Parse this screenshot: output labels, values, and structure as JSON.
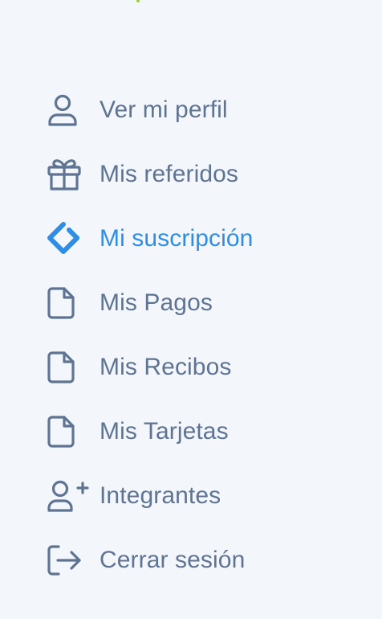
{
  "menu": {
    "items": [
      {
        "label": "Ver mi perfil",
        "icon": "user-icon",
        "active": false
      },
      {
        "label": "Mis referidos",
        "icon": "gift-icon",
        "active": false
      },
      {
        "label": "Mi suscripción",
        "icon": "subscription-tag-icon",
        "active": true
      },
      {
        "label": "Mis Pagos",
        "icon": "document-icon",
        "active": false
      },
      {
        "label": "Mis Recibos",
        "icon": "document-icon",
        "active": false
      },
      {
        "label": "Mis Tarjetas",
        "icon": "document-icon",
        "active": false
      },
      {
        "label": "Integrantes",
        "icon": "user-plus-icon",
        "active": false
      },
      {
        "label": "Cerrar sesión",
        "icon": "logout-icon",
        "active": false
      }
    ]
  },
  "colors": {
    "background": "#f3f7fb",
    "text": "#5f7393",
    "active": "#2f8ee2",
    "accent_top": "#9bd23c"
  }
}
